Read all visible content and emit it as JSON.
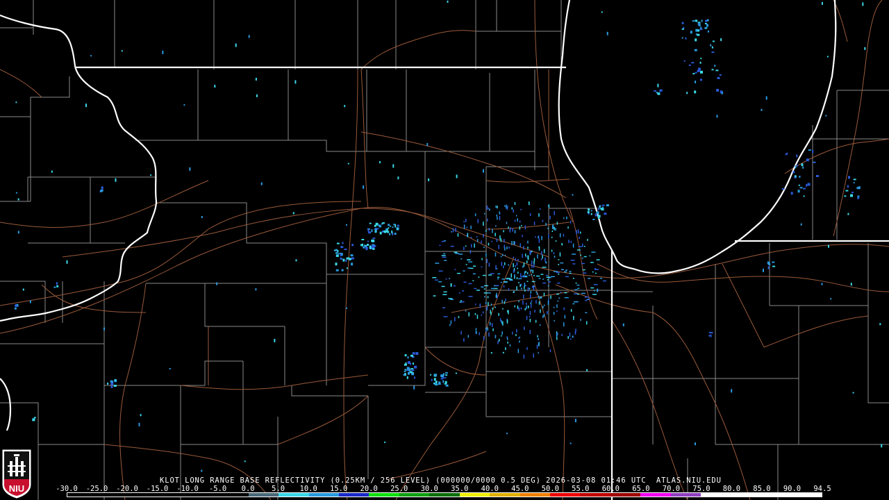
{
  "header": {
    "caption": "KLOT LONG RANGE BASE REFLECTIVITY (0.25KM / 256 LEVEL) (000000/0000 0.5 DEG) 2026-03-08 01:46 UTC  ATLAS.NIU.EDU"
  },
  "logo": {
    "text": "NIU"
  },
  "colors": {
    "background": "#000000",
    "state_border": "#ffffff",
    "county_line": "#8a8a8a",
    "highway": "#9a5a3a",
    "echo_light": "#2a9adf",
    "echo_cyan": "#3ad8e8",
    "echo_blue": "#2a5ad8"
  },
  "reflectivity_scale": {
    "labels": [
      "-30.0",
      "-25.0",
      "-20.0",
      "-15.0",
      "-10.0",
      "-5.0",
      "0.0",
      "5.0",
      "10.0",
      "15.0",
      "20.0",
      "25.0",
      "30.0",
      "35.0",
      "40.0",
      "45.0",
      "50.0",
      "55.0",
      "60.0",
      "65.0",
      "70.0",
      "75.0",
      "80.0",
      "85.0",
      "90.0",
      "94.5"
    ],
    "colors": [
      "#000000",
      "#000000",
      "#000000",
      "#000000",
      "#000000",
      "#000000",
      "#4a6a7a",
      "#3ad8e8",
      "#2a9adf",
      "#1a2ac8",
      "#10e010",
      "#10a010",
      "#0a700a",
      "#f0f000",
      "#e0b000",
      "#f08000",
      "#f00000",
      "#c00000",
      "#a00000",
      "#f000f0",
      "#9040c0",
      "#ffffff",
      "#ffffff",
      "#ffffff",
      "#ffffff"
    ]
  }
}
